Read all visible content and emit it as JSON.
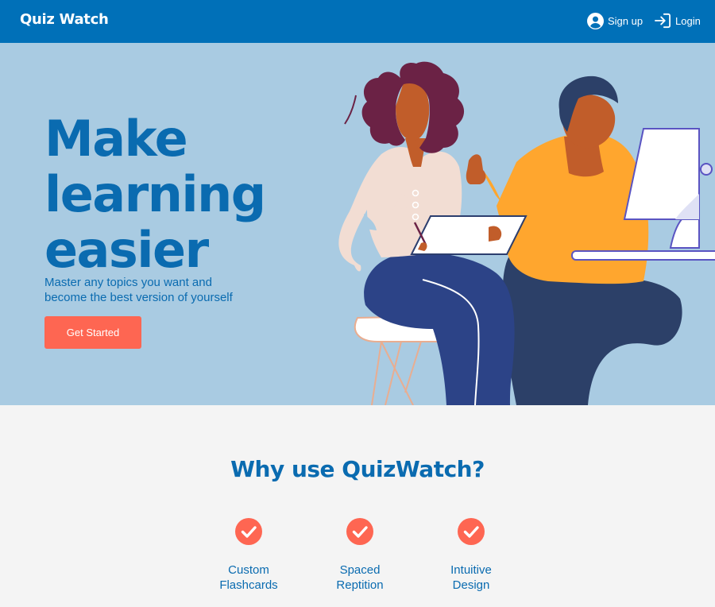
{
  "nav": {
    "brand": "Quiz Watch",
    "signup": {
      "label": "Sign up",
      "icon": "user-circle-icon"
    },
    "login": {
      "label": "Login",
      "icon": "login-icon"
    }
  },
  "hero": {
    "title_lines": [
      "Make",
      "learning",
      "easier"
    ],
    "subtitle": "Master any topics you want and become the best version of yourself",
    "cta_label": "Get Started"
  },
  "features": {
    "title": "Why use QuizWatch?",
    "items": [
      {
        "line1": "Custom",
        "line2": "Flashcards",
        "icon": "check-circle-icon"
      },
      {
        "line1": "Spaced",
        "line2": "Reptition",
        "icon": "check-circle-icon"
      },
      {
        "line1": "Intuitive",
        "line2": "Design",
        "icon": "check-circle-icon"
      }
    ]
  },
  "colors": {
    "nav_bg": "#0070b8",
    "hero_bg": "#a9cbe2",
    "brand_blue": "#0a6bb0",
    "cta_bg": "#fe6652",
    "page_bg": "#f4f4f4"
  }
}
